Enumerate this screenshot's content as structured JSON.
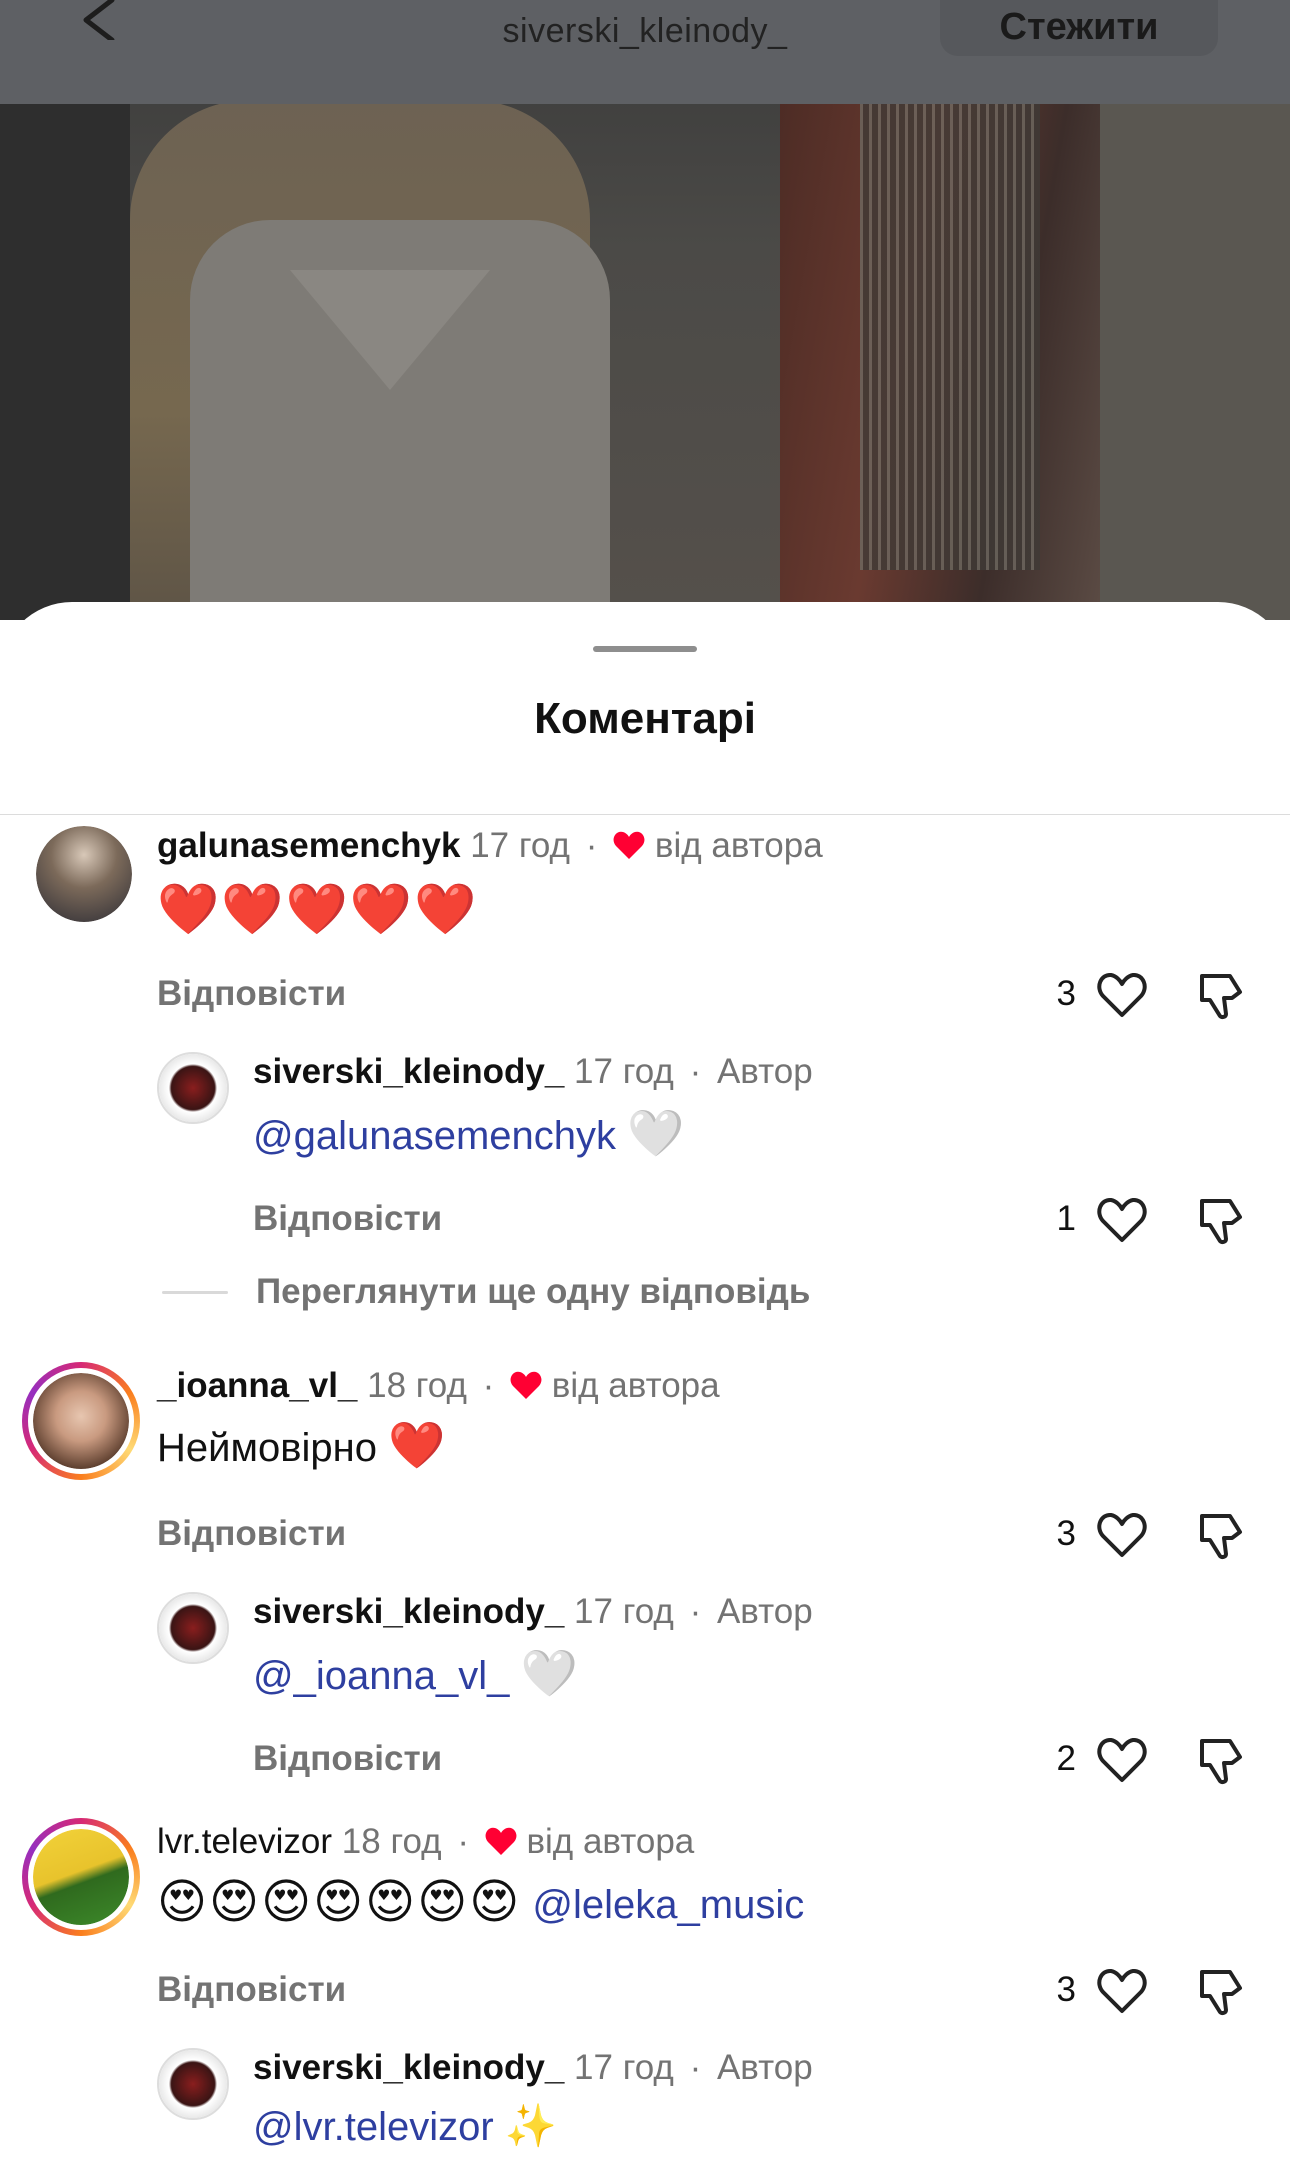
{
  "header": {
    "handle": "siverski_kleinody_",
    "follow_label": "Стежити"
  },
  "sheet": {
    "title": "Коментарі"
  },
  "comments": [
    {
      "user": "galunasemenchyk",
      "time": "17 год",
      "author_like_label": "від автора",
      "text_emojis": "❤️❤️❤️❤️❤️",
      "reply_label": "Відповісти",
      "likes": "3",
      "replies": [
        {
          "user": "siverski_kleinody_",
          "time": "17 год",
          "author_badge": "Автор",
          "mention": "@galunasemenchyk",
          "emoji": "🤍",
          "reply_label": "Відповісти",
          "likes": "1"
        }
      ],
      "view_more": "Переглянути ще одну відповідь"
    },
    {
      "user": "_ioanna_vl_",
      "time": "18 год",
      "author_like_label": "від автора",
      "text": "Неймовірно",
      "emoji": "❤️",
      "reply_label": "Відповісти",
      "likes": "3",
      "replies": [
        {
          "user": "siverski_kleinody_",
          "time": "17 год",
          "author_badge": "Автор",
          "mention": "@_ioanna_vl_",
          "emoji": "🤍",
          "reply_label": "Відповісти",
          "likes": "2"
        }
      ]
    },
    {
      "user": "lvr.televizor",
      "time": "18 год",
      "author_like_label": "від автора",
      "text_emojis": "😍😍😍😍😍😍😍",
      "mention": "@leleka_music",
      "reply_label": "Відповісти",
      "likes": "3",
      "replies": [
        {
          "user": "siverski_kleinody_",
          "time": "17 год",
          "author_badge": "Автор",
          "mention": "@lvr.televizor",
          "emoji": "✨"
        }
      ]
    }
  ],
  "colors": {
    "accent_heart": "#ff0033",
    "mention": "#2e3fa0",
    "muted": "#737373"
  },
  "icons": [
    "back-chevron-icon",
    "heart-icon",
    "dislike-icon",
    "red-heart-icon"
  ]
}
